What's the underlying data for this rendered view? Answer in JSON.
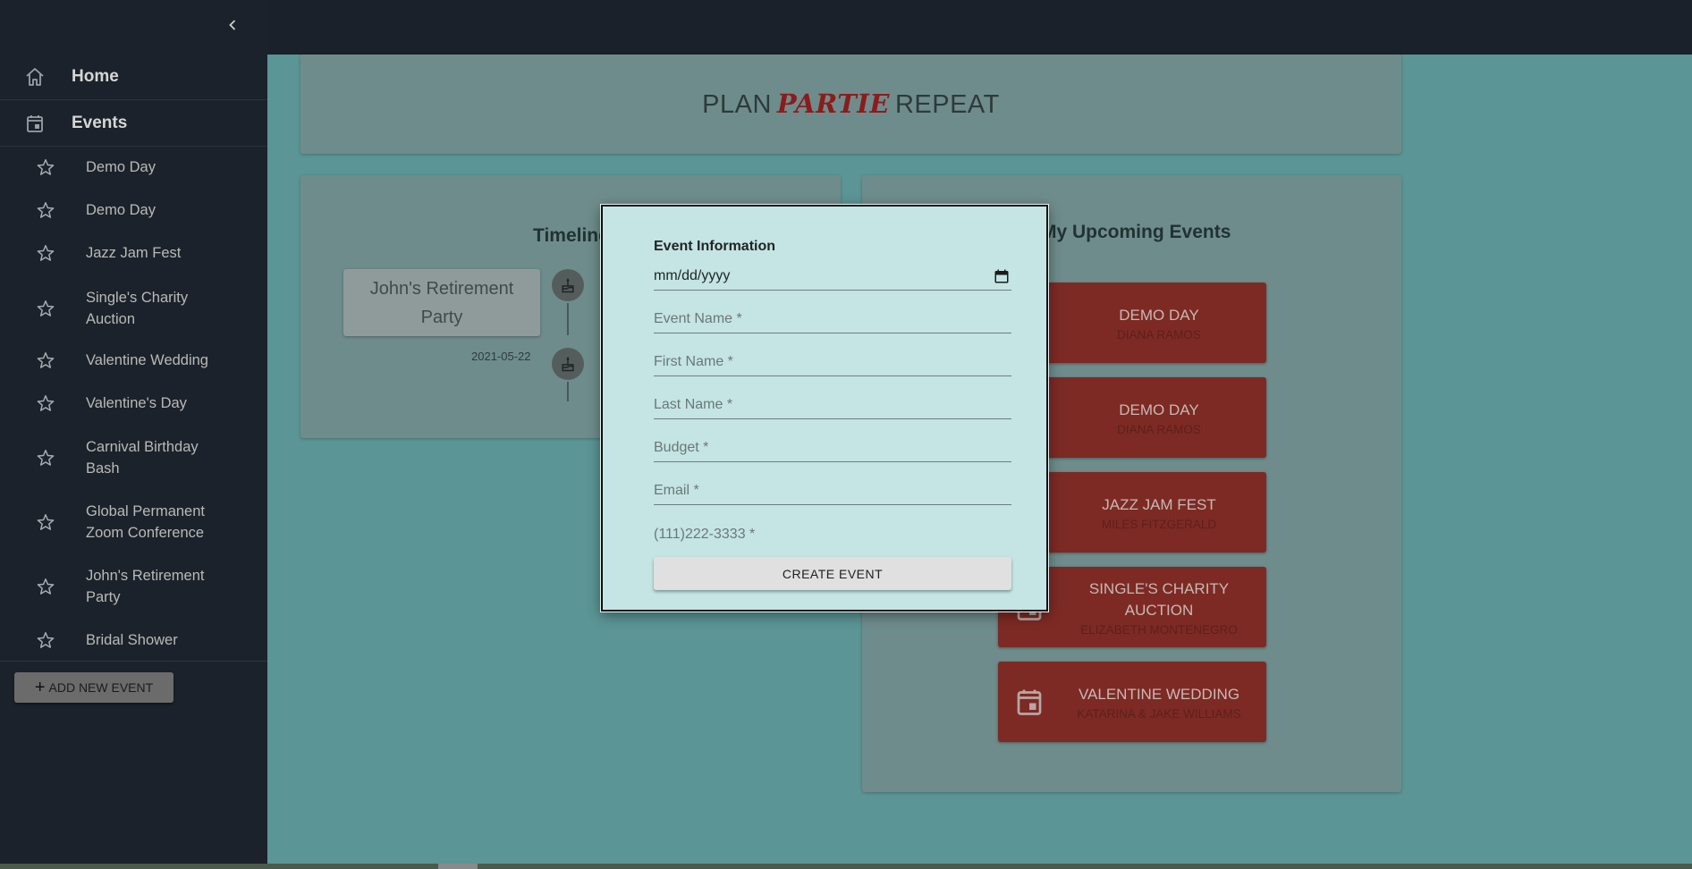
{
  "sidebar": {
    "collapse_icon": "chevron-left-icon",
    "nav": [
      {
        "label": "Home",
        "icon": "home-icon"
      },
      {
        "label": "Events",
        "icon": "calendar-icon"
      }
    ],
    "events": [
      {
        "label": "Demo Day"
      },
      {
        "label": "Demo Day"
      },
      {
        "label": "Jazz Jam Fest"
      },
      {
        "label": "Single's Charity Auction"
      },
      {
        "label": "Valentine Wedding"
      },
      {
        "label": "Valentine's Day"
      },
      {
        "label": "Carnival Birthday Bash"
      },
      {
        "label": "Global Permanent Zoom Conference"
      },
      {
        "label": "John's Retirement Party"
      },
      {
        "label": "Bridal Shower"
      }
    ],
    "add_button": "ADD NEW EVENT"
  },
  "header": {
    "title_prefix": "PLAN",
    "title_accent": "PARTIE",
    "title_suffix": "REPEAT"
  },
  "timeline": {
    "heading": "Timeline",
    "item": {
      "label": "John's Retirement Party",
      "date": "2021-05-22"
    }
  },
  "upcoming": {
    "heading": "My Upcoming Events",
    "events": [
      {
        "name": "DEMO DAY",
        "host": "DIANA RAMOS"
      },
      {
        "name": "DEMO DAY",
        "host": "DIANA RAMOS"
      },
      {
        "name": "JAZZ JAM FEST",
        "host": "MILES FITZGERALD"
      },
      {
        "name": "SINGLE'S CHARITY AUCTION",
        "host": "ELIZABETH MONTENEGRO"
      },
      {
        "name": "VALENTINE WEDDING",
        "host": "KATARINA & JAKE WILLIAMS"
      }
    ]
  },
  "modal": {
    "title": "Event Information",
    "date_placeholder": "mm/dd/yyyy",
    "fields": {
      "event_name": "Event Name *",
      "first_name": "First Name *",
      "last_name": "Last Name *",
      "budget": "Budget *",
      "email": "Email *",
      "phone": "(111)222-3333 *"
    },
    "submit": "CREATE EVENT"
  },
  "colors": {
    "sidebar_bg": "#1c222b",
    "accent_red": "#c0392b",
    "modal_bg": "#c5e4e4"
  }
}
